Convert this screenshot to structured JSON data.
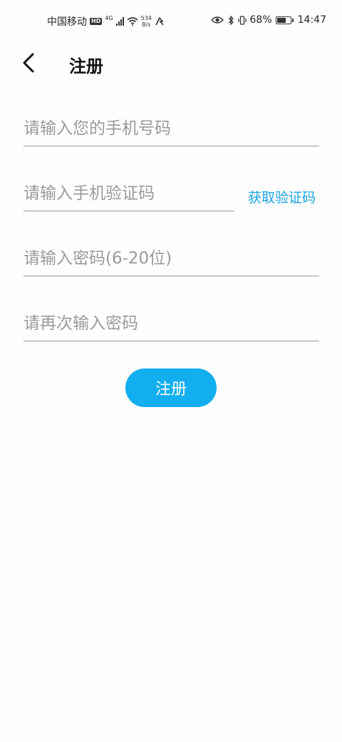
{
  "status_bar": {
    "carrier": "中国移动",
    "hd": "HD",
    "network": "4G",
    "speed_value": "534",
    "speed_unit": "B/s",
    "battery_percent": "68%",
    "battery_level": 0.68,
    "time": "14:47"
  },
  "header": {
    "title": "注册",
    "back_icon": "chevron-left-icon"
  },
  "form": {
    "phone_placeholder": "请输入您的手机号码",
    "code_placeholder": "请输入手机验证码",
    "get_code_label": "获取验证码",
    "password_placeholder": "请输入密码(6-20位)",
    "confirm_placeholder": "请再次输入密码",
    "submit_label": "注册"
  },
  "colors": {
    "accent": "#12aef0",
    "link": "#1aa4e6",
    "divider": "#9a9a9a"
  }
}
